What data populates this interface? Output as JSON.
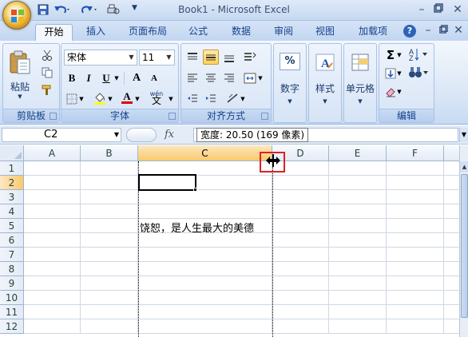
{
  "titlebar": {
    "title": "Book1 - Microsoft Excel",
    "quick_access": [
      "save",
      "undo",
      "redo",
      "customize"
    ]
  },
  "tabs": [
    {
      "label": "开始",
      "active": true
    },
    {
      "label": "插入",
      "active": false
    },
    {
      "label": "页面布局",
      "active": false
    },
    {
      "label": "公式",
      "active": false
    },
    {
      "label": "数据",
      "active": false
    },
    {
      "label": "审阅",
      "active": false
    },
    {
      "label": "视图",
      "active": false
    },
    {
      "label": "加载项",
      "active": false
    }
  ],
  "ribbon": {
    "clipboard": {
      "label": "剪贴板",
      "paste_label": "粘贴"
    },
    "font": {
      "label": "字体",
      "name": "宋体",
      "size": "11",
      "bold": "B",
      "italic": "I",
      "underline": "U",
      "grow": "A",
      "shrink": "A",
      "font_color_letter": "A",
      "phonetic": "wén",
      "phonetic_char": "文"
    },
    "alignment": {
      "label": "对齐方式"
    },
    "number": {
      "label": "数字",
      "symbol": "%"
    },
    "styles": {
      "label": "样式"
    },
    "cells": {
      "label": "单元格"
    },
    "editing": {
      "label": "编辑"
    }
  },
  "formula_bar": {
    "name_box": "C2",
    "fx": "fx",
    "content": ""
  },
  "tooltip": "宽度: 20.50 (169 像素)",
  "grid": {
    "columns": [
      "A",
      "B",
      "C",
      "D",
      "E",
      "F"
    ],
    "rows": [
      "1",
      "2",
      "3",
      "4",
      "5",
      "6",
      "7",
      "8",
      "9",
      "10",
      "11",
      "12"
    ],
    "active_cell": "C2",
    "active_column": "C",
    "active_row": "2",
    "cells": {
      "C5": "饶恕，是人生最大的美德"
    }
  },
  "colors": {
    "accent": "#15428b",
    "highlight": "#f9c96c",
    "callout": "#e02020"
  }
}
